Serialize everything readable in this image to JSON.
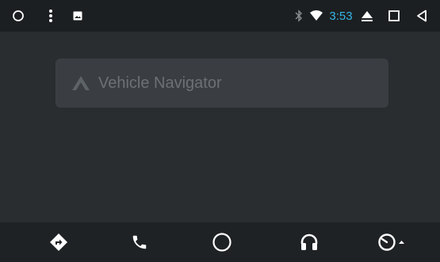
{
  "status_bar": {
    "left_icons": [
      "circle-icon",
      "overflow-menu-icon",
      "image-icon"
    ],
    "right_icons": [
      "bluetooth-icon",
      "wifi-icon",
      "eject-icon",
      "square-icon",
      "back-triangle-icon"
    ],
    "time": "3:53",
    "time_color": "#34b5e5"
  },
  "card": {
    "title": "Vehicle Navigator",
    "icon": "navigator-chevron-icon"
  },
  "nav_bar": {
    "items": [
      {
        "name": "navigation",
        "icon": "directions-icon"
      },
      {
        "name": "phone",
        "icon": "phone-icon"
      },
      {
        "name": "home",
        "icon": "home-circle-icon"
      },
      {
        "name": "audio",
        "icon": "headphones-icon"
      },
      {
        "name": "vehicle",
        "icon": "gauge-icon"
      }
    ]
  },
  "colors": {
    "background": "#2a2d30",
    "status_bar": "#1c1f21",
    "card": "#3a3e42",
    "icon": "#ffffff"
  }
}
